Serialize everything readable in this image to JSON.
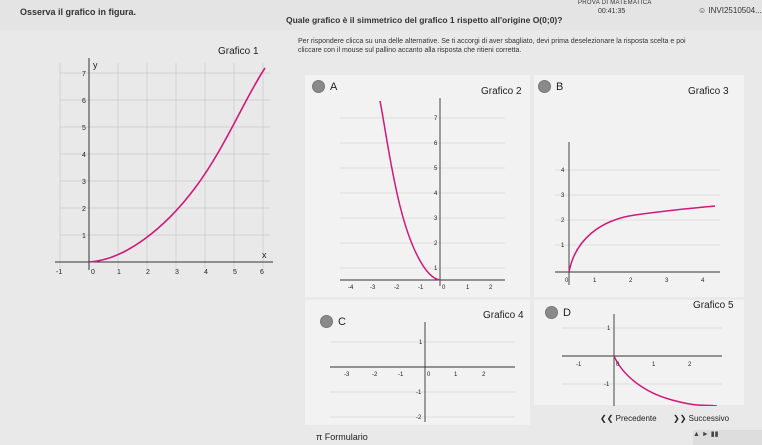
{
  "header": {
    "exam_title": "PROVA DI MATEMATICA",
    "timer": "00:41:35",
    "user_id": "INVI2510504..."
  },
  "question": {
    "left_prompt": "Osserva il grafico in figura.",
    "main_prompt": "Quale grafico è il simmetrico del grafico 1 rispetto all'origine O(0;0)?",
    "instruction_line1": "Per rispondere clicca su una delle alternative. Se ti accorgi di aver sbagliato, devi prima deselezionare la risposta scelta e poi",
    "instruction_line2": "cliccare con il mouse sul pallino accanto alla risposta che ritieni corretta."
  },
  "graph1": {
    "title": "Grafico 1",
    "x_ticks": [
      "-1",
      "0",
      "1",
      "2",
      "3",
      "4",
      "5",
      "6"
    ],
    "y_ticks": [
      "1",
      "2",
      "3",
      "4",
      "5",
      "6",
      "7"
    ],
    "axis_x": "x",
    "axis_y": "y"
  },
  "options": [
    {
      "letter": "A",
      "title": "Grafico 2",
      "x_ticks": [
        "-4",
        "-3",
        "-2",
        "-1",
        "0",
        "1",
        "2"
      ],
      "y_ticks": [
        "1",
        "2",
        "3",
        "4",
        "5",
        "6",
        "7"
      ]
    },
    {
      "letter": "B",
      "title": "Grafico 3",
      "x_ticks": [
        "0",
        "1",
        "2",
        "3",
        "4"
      ],
      "y_ticks": [
        "1",
        "2",
        "3",
        "4"
      ]
    },
    {
      "letter": "C",
      "title": "Grafico 4",
      "x_ticks": [
        "-3",
        "-2",
        "-1",
        "0",
        "1",
        "2"
      ],
      "y_ticks": [
        "1",
        "-1",
        "-2"
      ]
    },
    {
      "letter": "D",
      "title": "Grafico 5",
      "x_ticks": [
        "-1",
        "0",
        "1",
        "2"
      ],
      "y_ticks": [
        "1",
        "-1"
      ]
    }
  ],
  "nav": {
    "prev_label": "Precedente",
    "next_label": "Successivo",
    "formulario_label": "Formulario",
    "pi_symbol": "π"
  },
  "colors": {
    "curve": "#d0197a",
    "radio": "#8a8a8a"
  }
}
